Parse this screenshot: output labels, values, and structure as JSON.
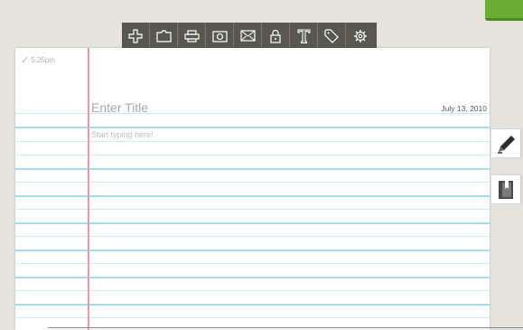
{
  "status": {
    "saved_time": "5:25pm"
  },
  "note": {
    "title_placeholder": "Enter Title",
    "date": "July 13, 2010",
    "body_placeholder": "Start typing here!"
  },
  "toolbar": {
    "icons": [
      "add-icon",
      "folder-icon",
      "print-icon",
      "camera-icon",
      "mail-icon",
      "lock-icon",
      "font-icon",
      "tag-icon",
      "settings-icon"
    ]
  },
  "side_tools": {
    "icons": [
      "pencil-icon",
      "notebook-icon"
    ]
  },
  "colors": {
    "background": "#e6e4df",
    "toolbar": "#58574f",
    "accent_green": "#6cab34",
    "rule_blue": "#a6dcea",
    "margin_red": "#e99aa3"
  }
}
